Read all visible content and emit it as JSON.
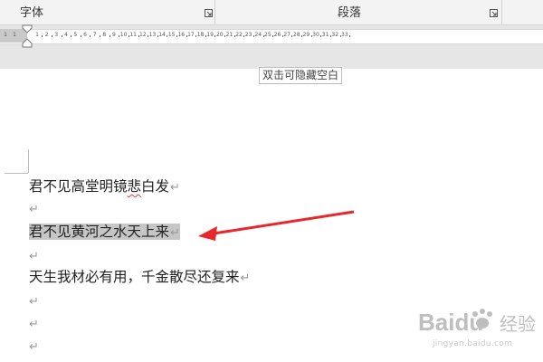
{
  "ribbon": {
    "groups": [
      {
        "label": "字体"
      },
      {
        "label": "段落"
      }
    ]
  },
  "ruler": {
    "left_ticks": [
      "1",
      "1"
    ],
    "ticks": [
      "1",
      "2",
      "3",
      "4",
      "5",
      "6",
      "7",
      "8",
      "9",
      "10",
      "11",
      "12",
      "13",
      "14",
      "15",
      "16",
      "17",
      "18",
      "19",
      "20",
      "21",
      "22",
      "23",
      "24",
      "25",
      "26",
      "27",
      "28",
      "29",
      "30",
      "31",
      "32",
      "33"
    ]
  },
  "tooltip": {
    "hide_whitespace": "双击可隐藏空白"
  },
  "document": {
    "paragraph_mark": "↵",
    "lines": [
      {
        "before": "君不见高堂明镜",
        "misspelled": "悲",
        "after": "白发"
      },
      {
        "text": ""
      },
      {
        "text": "君不见黄河之水天上来",
        "selected": true
      },
      {
        "text": ""
      },
      {
        "text": "天生我材必有用，千金散尽还复来"
      },
      {
        "text": ""
      },
      {
        "text": ""
      },
      {
        "text": ""
      }
    ]
  },
  "annotation": {
    "arrow_color": "#e8262b"
  },
  "watermark": {
    "brand": "Baidu",
    "brand_cn": "经验",
    "url": "jingyan.baidu.com"
  }
}
